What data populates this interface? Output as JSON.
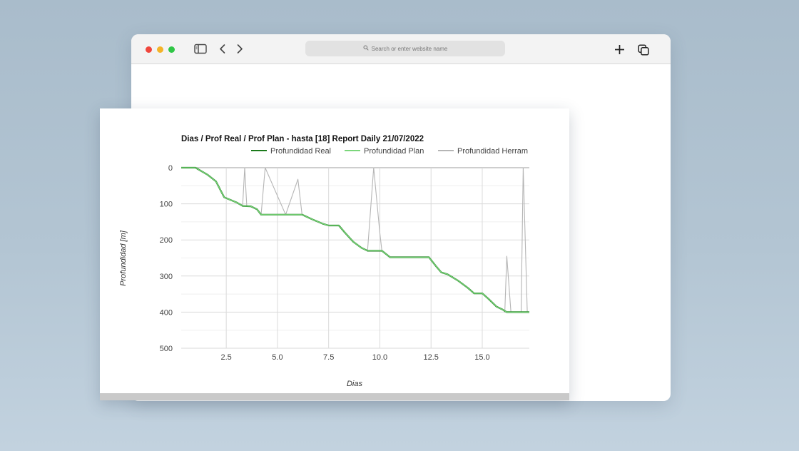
{
  "browser": {
    "address_placeholder": "Search or enter website name",
    "icons": [
      "sidebar-icon",
      "back-chevron-icon",
      "forward-chevron-icon",
      "search-icon",
      "new-tab-plus-icon",
      "tabs-overview-icon"
    ]
  },
  "chart_data": {
    "type": "line",
    "title": "Dias / Prof Real / Prof Plan - hasta [18] Report Daily 21/07/2022",
    "xlabel": "Dias",
    "ylabel": "Profundidad [m]",
    "xlim": [
      0.3,
      17.3
    ],
    "ylim": [
      0,
      500
    ],
    "y_reversed": true,
    "xticks": [
      "2.5",
      "5.0",
      "7.5",
      "10.0",
      "12.5",
      "15.0"
    ],
    "yticks": [
      "0",
      "100",
      "200",
      "300",
      "400",
      "500"
    ],
    "grid": true,
    "legend_position": "top",
    "series": [
      {
        "name": "Profundidad Real",
        "color": "#1b7a1b",
        "points": [
          [
            0.3,
            0
          ],
          [
            1.0,
            0
          ],
          [
            1.3,
            10
          ],
          [
            1.6,
            20
          ],
          [
            2.0,
            38
          ],
          [
            2.2,
            60
          ],
          [
            2.4,
            82
          ],
          [
            3.0,
            96
          ],
          [
            3.3,
            106
          ],
          [
            3.7,
            107
          ],
          [
            4.0,
            115
          ],
          [
            4.2,
            130
          ],
          [
            4.6,
            130
          ],
          [
            5.3,
            130
          ],
          [
            6.2,
            130
          ],
          [
            6.7,
            143
          ],
          [
            7.2,
            155
          ],
          [
            7.5,
            160
          ],
          [
            8.0,
            160
          ],
          [
            8.3,
            180
          ],
          [
            8.7,
            205
          ],
          [
            9.1,
            222
          ],
          [
            9.4,
            230
          ],
          [
            9.7,
            230
          ],
          [
            10.1,
            230
          ],
          [
            10.5,
            248
          ],
          [
            11.0,
            248
          ],
          [
            11.5,
            248
          ],
          [
            12.4,
            248
          ],
          [
            12.7,
            270
          ],
          [
            13.0,
            290
          ],
          [
            13.3,
            295
          ],
          [
            13.8,
            312
          ],
          [
            14.3,
            333
          ],
          [
            14.6,
            348
          ],
          [
            15.0,
            348
          ],
          [
            15.3,
            363
          ],
          [
            15.7,
            385
          ],
          [
            16.0,
            393
          ],
          [
            16.2,
            400
          ],
          [
            16.8,
            400
          ],
          [
            17.3,
            400
          ]
        ]
      },
      {
        "name": "Profundidad Plan",
        "color": "#7bd67b",
        "points": [
          [
            0.3,
            0
          ],
          [
            1.0,
            0
          ],
          [
            1.3,
            10
          ],
          [
            1.6,
            20
          ],
          [
            2.0,
            38
          ],
          [
            2.2,
            60
          ],
          [
            2.4,
            82
          ],
          [
            3.0,
            96
          ],
          [
            3.3,
            106
          ],
          [
            3.7,
            107
          ],
          [
            4.0,
            115
          ],
          [
            4.2,
            130
          ],
          [
            5.3,
            130
          ],
          [
            6.2,
            130
          ],
          [
            6.7,
            143
          ],
          [
            7.2,
            155
          ],
          [
            7.5,
            160
          ],
          [
            8.0,
            160
          ],
          [
            8.3,
            180
          ],
          [
            8.7,
            205
          ],
          [
            9.1,
            222
          ],
          [
            9.4,
            230
          ],
          [
            10.1,
            230
          ],
          [
            10.5,
            248
          ],
          [
            12.4,
            248
          ],
          [
            12.7,
            270
          ],
          [
            13.0,
            290
          ],
          [
            13.3,
            295
          ],
          [
            13.8,
            312
          ],
          [
            14.3,
            333
          ],
          [
            14.6,
            348
          ],
          [
            15.0,
            348
          ],
          [
            15.3,
            363
          ],
          [
            15.7,
            385
          ],
          [
            16.0,
            393
          ],
          [
            16.2,
            400
          ],
          [
            17.3,
            400
          ]
        ]
      },
      {
        "name": "Profundidad Herram",
        "color": "#b5b5b5",
        "points": [
          [
            0.3,
            0
          ],
          [
            1.0,
            0
          ],
          [
            1.3,
            10
          ],
          [
            1.6,
            20
          ],
          [
            2.0,
            38
          ],
          [
            2.2,
            60
          ],
          [
            2.4,
            82
          ],
          [
            3.0,
            96
          ],
          [
            3.3,
            106
          ],
          [
            3.4,
            0
          ],
          [
            3.5,
            106
          ],
          [
            3.7,
            107
          ],
          [
            4.0,
            115
          ],
          [
            4.2,
            130
          ],
          [
            4.4,
            0
          ],
          [
            5.4,
            130
          ],
          [
            6.0,
            32
          ],
          [
            6.2,
            130
          ],
          [
            6.7,
            143
          ],
          [
            7.2,
            155
          ],
          [
            7.5,
            160
          ],
          [
            8.0,
            160
          ],
          [
            8.3,
            180
          ],
          [
            8.7,
            205
          ],
          [
            9.1,
            222
          ],
          [
            9.4,
            230
          ],
          [
            9.7,
            0
          ],
          [
            10.0,
            180
          ],
          [
            10.1,
            230
          ],
          [
            10.5,
            248
          ],
          [
            12.4,
            248
          ],
          [
            12.7,
            270
          ],
          [
            13.0,
            290
          ],
          [
            13.3,
            295
          ],
          [
            13.8,
            312
          ],
          [
            14.3,
            333
          ],
          [
            14.6,
            348
          ],
          [
            15.0,
            348
          ],
          [
            15.3,
            363
          ],
          [
            15.7,
            385
          ],
          [
            16.0,
            393
          ],
          [
            16.1,
            400
          ],
          [
            16.2,
            245
          ],
          [
            16.4,
            400
          ],
          [
            16.9,
            400
          ],
          [
            17.0,
            0
          ],
          [
            17.2,
            400
          ],
          [
            17.3,
            400
          ]
        ]
      }
    ]
  }
}
